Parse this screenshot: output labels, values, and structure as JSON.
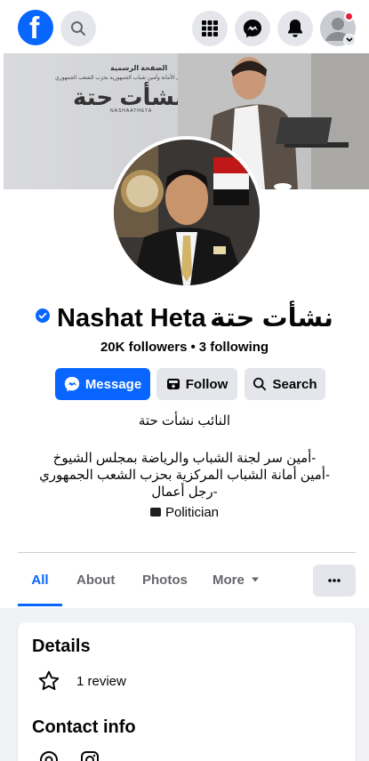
{
  "page": {
    "name": "Nashat Heta",
    "name_ar": "نشأت حتة",
    "followers": "20K followers",
    "separator": "•",
    "following": "3 following"
  },
  "cover": {
    "line1": "الصفحة الرسمية",
    "line2": "أول الأمانة وأمين شباب الجمهورية بحزب الشعب الجمهوري",
    "title": "نشأت حتة",
    "handle": "NASHAATHETA"
  },
  "actions": {
    "message_label": "Message",
    "follow_label": "Follow",
    "search_label": "Search"
  },
  "bio": {
    "title": "النائب نشأت حتة",
    "lines": [
      "-أمين سر لجنة الشباب والرياضة بمجلس الشيوخ",
      "-أمين أمانة الشباب المركزية بحزب الشعب الجمهوري",
      "-رجل أعمال"
    ],
    "category": "Politician"
  },
  "tabs": {
    "all": "All",
    "about": "About",
    "photos": "Photos",
    "more": "More"
  },
  "details": {
    "heading": "Details",
    "review": "1 review",
    "contact_heading": "Contact info"
  },
  "colors": {
    "brand_blue": "#0866ff",
    "button_grey": "#e4e6eb",
    "notification_red": "#e41e3f"
  },
  "icons": [
    "facebook-logo",
    "search-icon",
    "menu-grid-icon",
    "messenger-icon",
    "bell-icon",
    "account-avatar",
    "verified-badge-icon",
    "add-friend-icon",
    "star-icon",
    "instagram-icon"
  ]
}
